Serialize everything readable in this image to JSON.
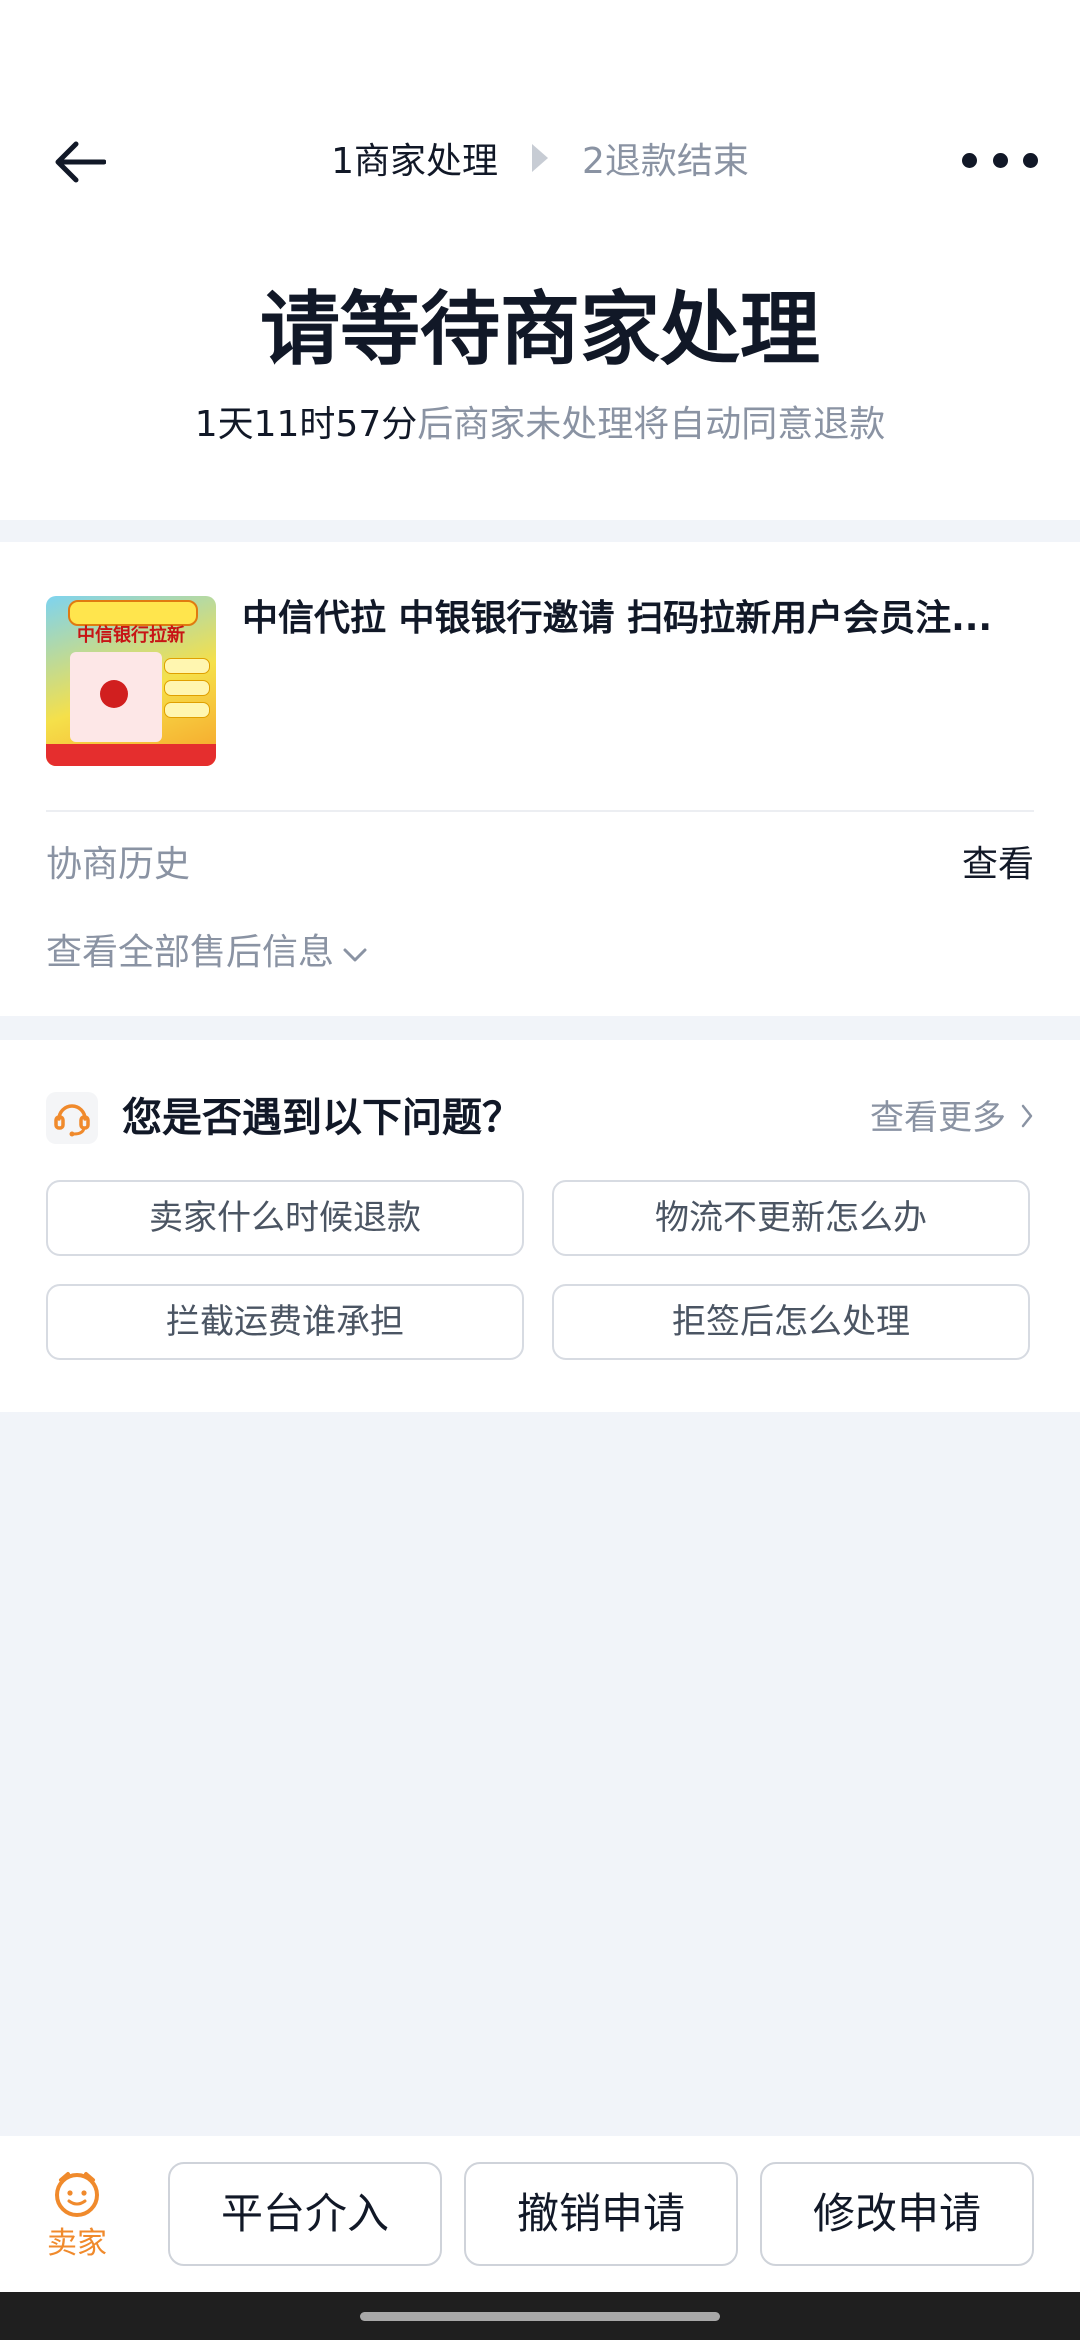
{
  "steps": {
    "step1": "1商家处理",
    "step2": "2退款结束"
  },
  "status": {
    "title": "请等待商家处理",
    "countdown": "1天11时57分",
    "countdown_suffix": "后商家未处理将自动同意退款"
  },
  "product": {
    "title": "中信代拉 中银银行邀请 扫码拉新用户会员注...",
    "thumbnail_text": "中信银行拉新"
  },
  "history": {
    "label": "协商历史",
    "link": "查看"
  },
  "after_sales": {
    "label": "查看全部售后信息"
  },
  "faq": {
    "title": "您是否遇到以下问题？",
    "more": "查看更多",
    "questions": [
      "卖家什么时候退款",
      "物流不更新怎么办",
      "拦截运费谁承担",
      "拒签后怎么处理"
    ]
  },
  "bottom_bar": {
    "seller_label": "卖家",
    "buttons": [
      "平台介入",
      "撤销申请",
      "修改申请"
    ]
  },
  "colors": {
    "accent_orange": "#f08a2c",
    "text_primary": "#111827",
    "text_secondary": "#8a93a3",
    "page_background": "#f1f4f9"
  },
  "icons": [
    "back-arrow-icon",
    "more-dots-icon",
    "customer-service-icon",
    "chevron-right-icon",
    "chevron-down-icon",
    "seller-face-icon"
  ]
}
